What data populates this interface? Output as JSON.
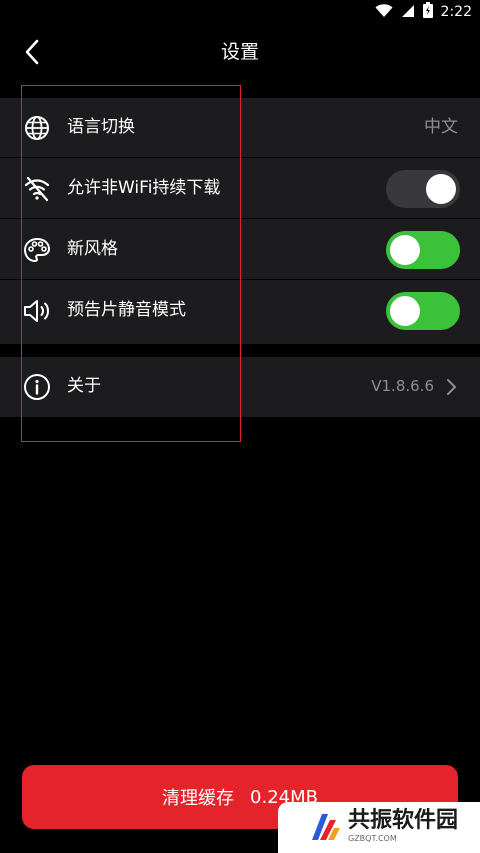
{
  "status_bar": {
    "time": "2:22"
  },
  "nav": {
    "title": "设置"
  },
  "settings": {
    "language": {
      "label": "语言切换",
      "value": "中文",
      "icon": "globe-icon"
    },
    "wifi_download": {
      "label": "允许非WiFi持续下载",
      "enabled": false,
      "icon": "wifi-off-icon"
    },
    "new_style": {
      "label": "新风格",
      "enabled": true,
      "icon": "palette-icon"
    },
    "trailer_mute": {
      "label": "预告片静音模式",
      "enabled": true,
      "icon": "speaker-icon"
    },
    "about": {
      "label": "关于",
      "value": "V1.8.6.6",
      "icon": "info-icon"
    }
  },
  "clear_cache": {
    "label": "清理缓存",
    "size": "0.24MB"
  },
  "watermark": {
    "text": "共振软件园",
    "sub": "GZBQT.COM"
  },
  "colors": {
    "background": "#000000",
    "row_background": "#1c1c1e",
    "toggle_on": "#3cc13b",
    "toggle_off": "#39393d",
    "primary_button": "#e5232b",
    "highlight_box": "#e0202a",
    "secondary_text": "#8e8e93"
  }
}
